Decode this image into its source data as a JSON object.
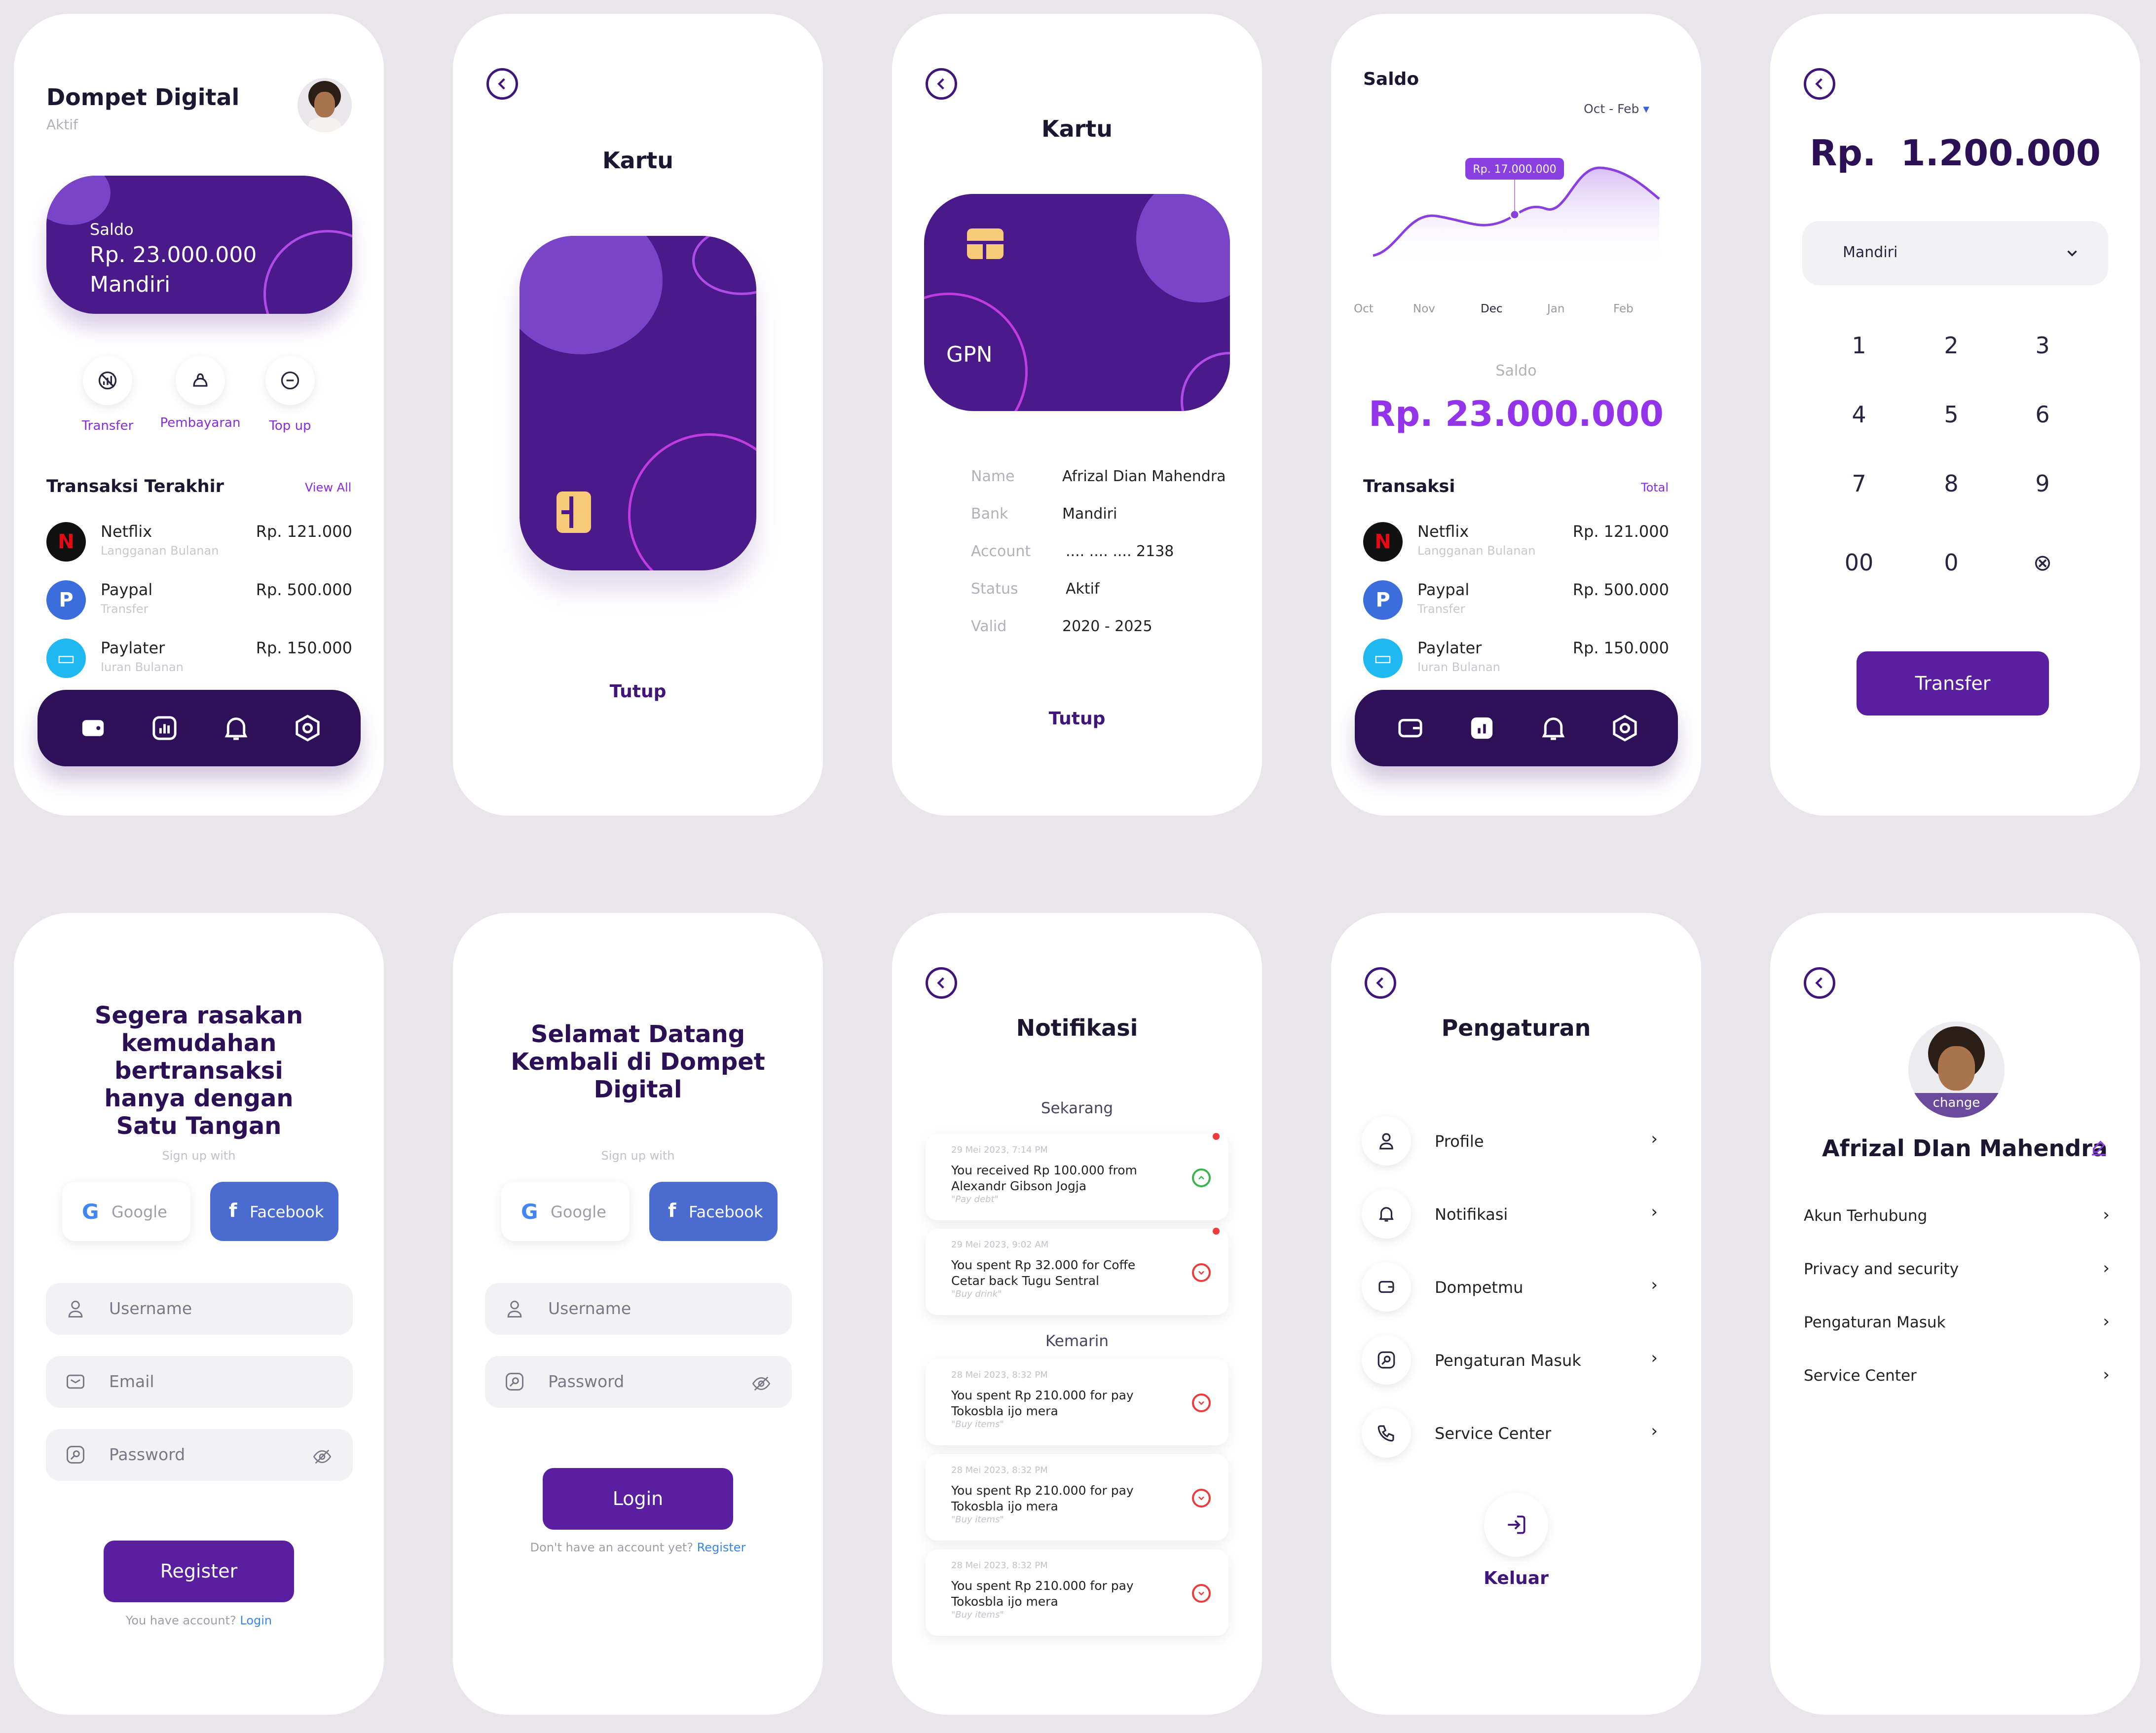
{
  "home": {
    "title": "Dompet Digital",
    "status": "Aktif",
    "card": {
      "label": "Saldo",
      "amount": "Rp. 23.000.000",
      "bank": "Mandiri"
    },
    "actions": [
      {
        "label": "Transfer",
        "icon": "no-signal-icon"
      },
      {
        "label": "Pembayaran",
        "icon": "bag-icon"
      },
      {
        "label": "Top up",
        "icon": "minus-circle-icon"
      }
    ],
    "section": "Transaksi Terakhir",
    "view_all": "View All",
    "transactions": [
      {
        "logo": "N",
        "name": "Netflix",
        "sub": "Langganan Bulanan",
        "amount": "Rp. 121.000"
      },
      {
        "logo": "P",
        "name": "Paypal",
        "sub": "Transfer",
        "amount": "Rp. 500.000"
      },
      {
        "logo": "▭",
        "name": "Paylater",
        "sub": "Iuran Bulanan",
        "amount": "Rp. 150.000"
      }
    ]
  },
  "kartu1": {
    "title": "Kartu",
    "close": "Tutup"
  },
  "kartu2": {
    "title": "Kartu",
    "card_brand": "GPN",
    "close": "Tutup",
    "fields": [
      {
        "label": "Name",
        "value": "Afrizal Dian Mahendra"
      },
      {
        "label": "Bank",
        "value": "Mandiri"
      },
      {
        "label": "Account",
        "value": ".... .... .... 2138"
      },
      {
        "label": "Status",
        "value": "Aktif"
      },
      {
        "label": "Valid",
        "value": "2020 - 2025"
      }
    ]
  },
  "stats": {
    "title": "Saldo",
    "range": "Oct - Feb",
    "tooltip": "Rp. 17.000.000",
    "balance_label": "Saldo",
    "balance": "Rp. 23.000.000",
    "section": "Transaksi",
    "total_link": "Total",
    "chart_data": {
      "type": "area",
      "x": [
        "Oct",
        "Nov",
        "Dec",
        "Jan",
        "Feb"
      ],
      "highlight": "Dec",
      "highlight_label": "Rp. 17.000.000"
    },
    "transactions": [
      {
        "logo": "N",
        "name": "Netflix",
        "sub": "Langganan Bulanan",
        "amount": "Rp. 121.000"
      },
      {
        "logo": "P",
        "name": "Paypal",
        "sub": "Transfer",
        "amount": "Rp. 500.000"
      },
      {
        "logo": "▭",
        "name": "Paylater",
        "sub": "Iuran Bulanan",
        "amount": "Rp. 150.000"
      }
    ]
  },
  "transfer": {
    "currency": "Rp.",
    "amount": "1.200.000",
    "bank_select": "Mandiri",
    "keys": [
      "1",
      "2",
      "3",
      "4",
      "5",
      "6",
      "7",
      "8",
      "9",
      "00",
      "0",
      "⊗"
    ],
    "button": "Transfer"
  },
  "register": {
    "headline": "Segera rasakan kemudahan bertransaksi hanya dengan Satu Tangan",
    "signup_with": "Sign up with",
    "google": "Google",
    "facebook": "Facebook",
    "username_ph": "Username",
    "email_ph": "Email",
    "password_ph": "Password",
    "button": "Register",
    "footer_text": "You have account?",
    "footer_link": "Login"
  },
  "login": {
    "headline": "Selamat Datang Kembali di Dompet Digital",
    "signup_with": "Sign up with",
    "google": "Google",
    "facebook": "Facebook",
    "username_ph": "Username",
    "password_ph": "Password",
    "button": "Login",
    "footer_text": "Don't have an account yet?",
    "footer_link": "Register"
  },
  "notifications": {
    "title": "Notifikasi",
    "group_now": "Sekarang",
    "group_yesterday": "Kemarin",
    "items": [
      {
        "time": "29 Mei 2023, 7:14 PM",
        "message": "You received Rp 100.000 from Alexandr Gibson Jogja",
        "note": "\"Pay debt\"",
        "type": "in",
        "unread": true
      },
      {
        "time": "29 Mei 2023, 9:02 AM",
        "message": "You spent Rp 32.000 for Coffe Cetar back Tugu Sentral",
        "note": "\"Buy drink\"",
        "type": "out",
        "unread": true
      },
      {
        "time": "28 Mei 2023, 8:32 PM",
        "message": "You spent Rp 210.000 for pay Tokosbla ijo mera",
        "note": "\"Buy items\"",
        "type": "out",
        "unread": false
      },
      {
        "time": "28 Mei 2023, 8:32 PM",
        "message": "You spent Rp 210.000 for pay Tokosbla ijo mera",
        "note": "\"Buy items\"",
        "type": "out",
        "unread": false
      },
      {
        "time": "28 Mei 2023, 8:32 PM",
        "message": "You spent Rp 210.000 for pay Tokosbla ijo mera",
        "note": "\"Buy items\"",
        "type": "out",
        "unread": false
      }
    ]
  },
  "settings": {
    "title": "Pengaturan",
    "items": [
      {
        "label": "Profile"
      },
      {
        "label": "Notifikasi"
      },
      {
        "label": "Dompetmu"
      },
      {
        "label": "Pengaturan Masuk"
      },
      {
        "label": "Service Center"
      }
    ],
    "logout": "Keluar"
  },
  "profile": {
    "change": "change",
    "name": "Afrizal DIan Mahendra",
    "items": [
      {
        "label": "Akun Terhubung"
      },
      {
        "label": "Privacy and security"
      },
      {
        "label": "Pengaturan Masuk"
      },
      {
        "label": "Service Center"
      }
    ]
  },
  "colors": {
    "primary": "#3f177b",
    "accent": "#9333ea",
    "bg": "#e8e6ea",
    "error": "#ef3b3b",
    "success": "#39b54a"
  }
}
